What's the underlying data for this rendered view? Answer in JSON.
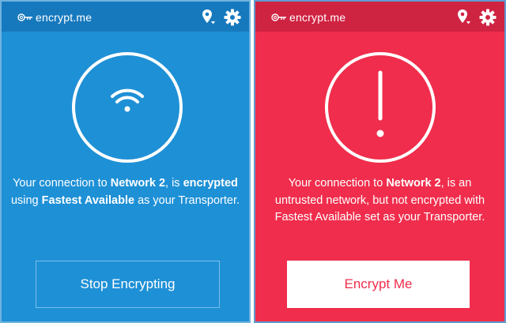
{
  "colors": {
    "encrypted_bg": "#1e90d6",
    "encrypted_titlebar": "#1779bd",
    "unencrypted_bg": "#f02d4c",
    "unencrypted_titlebar": "#cf2342"
  },
  "panels": [
    {
      "app_name": "encrypt.me",
      "status_icon": "wifi-icon",
      "message": {
        "p1": "Your connection to ",
        "network": "Network  2",
        "p2": ", is ",
        "state": "encrypted",
        "p3": " using ",
        "transporter": "Fastest Available",
        "p4": " as your Transporter."
      },
      "button_label": "Stop Encrypting"
    },
    {
      "app_name": "encrypt.me",
      "status_icon": "exclamation-icon",
      "message": {
        "p1": "Your connection to ",
        "network": "Network  2",
        "p2": ", is an untrusted network, but not encrypted with Fastest Available set as your Transporter."
      },
      "button_label": "Encrypt Me"
    }
  ]
}
